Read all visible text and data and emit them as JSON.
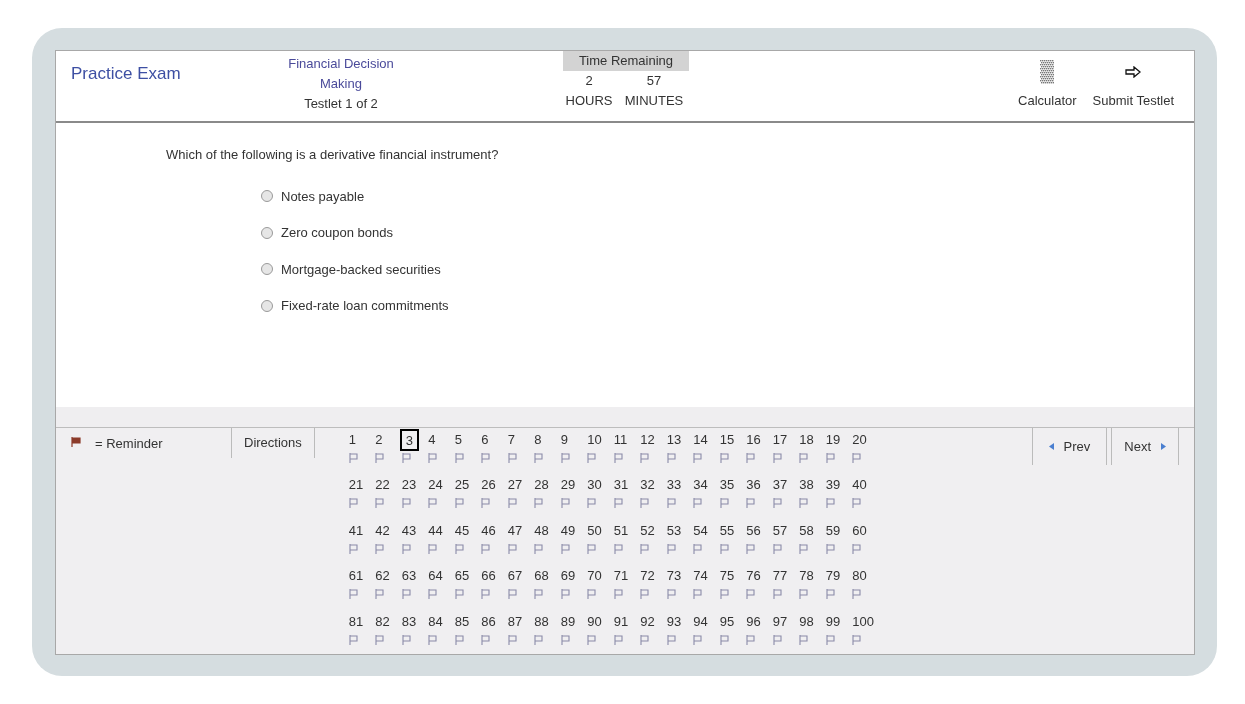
{
  "header": {
    "title": "Practice Exam",
    "section": "Financial Decision Making",
    "testlet": "Testlet 1 of 2",
    "timer": {
      "label": "Time Remaining",
      "hours": "2",
      "minutes": "57",
      "hours_label": "HOURS",
      "minutes_label": "MINUTES"
    },
    "tools": [
      {
        "kind": "calculator",
        "label": "Calculator"
      },
      {
        "kind": "submit",
        "label": "Submit Testlet"
      }
    ]
  },
  "question": {
    "text": "Which of the following is a derivative financial instrument?",
    "options": [
      {
        "label": "Notes payable",
        "selected": false
      },
      {
        "label": "Zero coupon bonds",
        "selected": false
      },
      {
        "label": "Mortgage-backed securities",
        "selected": false
      },
      {
        "label": "Fixed-rate loan commitments",
        "selected": false
      }
    ]
  },
  "footer": {
    "legend": "= Reminder",
    "directions": "Directions",
    "prev": "Prev",
    "next": "Next",
    "questions": [
      {
        "number": "1",
        "selected": false
      },
      {
        "number": "2",
        "selected": false
      },
      {
        "number": "3",
        "selected": true
      },
      {
        "number": "4",
        "selected": false
      },
      {
        "number": "5",
        "selected": false
      },
      {
        "number": "6",
        "selected": false
      },
      {
        "number": "7",
        "selected": false
      },
      {
        "number": "8",
        "selected": false
      },
      {
        "number": "9",
        "selected": false
      },
      {
        "number": "10",
        "selected": false
      },
      {
        "number": "11",
        "selected": false
      },
      {
        "number": "12",
        "selected": false
      },
      {
        "number": "13",
        "selected": false
      },
      {
        "number": "14",
        "selected": false
      },
      {
        "number": "15",
        "selected": false
      },
      {
        "number": "16",
        "selected": false
      },
      {
        "number": "17",
        "selected": false
      },
      {
        "number": "18",
        "selected": false
      },
      {
        "number": "19",
        "selected": false
      },
      {
        "number": "20",
        "selected": false
      },
      {
        "number": "21",
        "selected": false
      },
      {
        "number": "22",
        "selected": false
      },
      {
        "number": "23",
        "selected": false
      },
      {
        "number": "24",
        "selected": false
      },
      {
        "number": "25",
        "selected": false
      },
      {
        "number": "26",
        "selected": false
      },
      {
        "number": "27",
        "selected": false
      },
      {
        "number": "28",
        "selected": false
      },
      {
        "number": "29",
        "selected": false
      },
      {
        "number": "30",
        "selected": false
      },
      {
        "number": "31",
        "selected": false
      },
      {
        "number": "32",
        "selected": false
      },
      {
        "number": "33",
        "selected": false
      },
      {
        "number": "34",
        "selected": false
      },
      {
        "number": "35",
        "selected": false
      },
      {
        "number": "36",
        "selected": false
      },
      {
        "number": "37",
        "selected": false
      },
      {
        "number": "38",
        "selected": false
      },
      {
        "number": "39",
        "selected": false
      },
      {
        "number": "40",
        "selected": false
      },
      {
        "number": "41",
        "selected": false
      },
      {
        "number": "42",
        "selected": false
      },
      {
        "number": "43",
        "selected": false
      },
      {
        "number": "44",
        "selected": false
      },
      {
        "number": "45",
        "selected": false
      },
      {
        "number": "46",
        "selected": false
      },
      {
        "number": "47",
        "selected": false
      },
      {
        "number": "48",
        "selected": false
      },
      {
        "number": "49",
        "selected": false
      },
      {
        "number": "50",
        "selected": false
      },
      {
        "number": "51",
        "selected": false
      },
      {
        "number": "52",
        "selected": false
      },
      {
        "number": "53",
        "selected": false
      },
      {
        "number": "54",
        "selected": false
      },
      {
        "number": "55",
        "selected": false
      },
      {
        "number": "56",
        "selected": false
      },
      {
        "number": "57",
        "selected": false
      },
      {
        "number": "58",
        "selected": false
      },
      {
        "number": "59",
        "selected": false
      },
      {
        "number": "60",
        "selected": false
      },
      {
        "number": "61",
        "selected": false
      },
      {
        "number": "62",
        "selected": false
      },
      {
        "number": "63",
        "selected": false
      },
      {
        "number": "64",
        "selected": false
      },
      {
        "number": "65",
        "selected": false
      },
      {
        "number": "66",
        "selected": false
      },
      {
        "number": "67",
        "selected": false
      },
      {
        "number": "68",
        "selected": false
      },
      {
        "number": "69",
        "selected": false
      },
      {
        "number": "70",
        "selected": false
      },
      {
        "number": "71",
        "selected": false
      },
      {
        "number": "72",
        "selected": false
      },
      {
        "number": "73",
        "selected": false
      },
      {
        "number": "74",
        "selected": false
      },
      {
        "number": "75",
        "selected": false
      },
      {
        "number": "76",
        "selected": false
      },
      {
        "number": "77",
        "selected": false
      },
      {
        "number": "78",
        "selected": false
      },
      {
        "number": "79",
        "selected": false
      },
      {
        "number": "80",
        "selected": false
      },
      {
        "number": "81",
        "selected": false
      },
      {
        "number": "82",
        "selected": false
      },
      {
        "number": "83",
        "selected": false
      },
      {
        "number": "84",
        "selected": false
      },
      {
        "number": "85",
        "selected": false
      },
      {
        "number": "86",
        "selected": false
      },
      {
        "number": "87",
        "selected": false
      },
      {
        "number": "88",
        "selected": false
      },
      {
        "number": "89",
        "selected": false
      },
      {
        "number": "90",
        "selected": false
      },
      {
        "number": "91",
        "selected": false
      },
      {
        "number": "92",
        "selected": false
      },
      {
        "number": "93",
        "selected": false
      },
      {
        "number": "94",
        "selected": false
      },
      {
        "number": "95",
        "selected": false
      },
      {
        "number": "96",
        "selected": false
      },
      {
        "number": "97",
        "selected": false
      },
      {
        "number": "98",
        "selected": false
      },
      {
        "number": "99",
        "selected": false
      },
      {
        "number": "100",
        "selected": false
      }
    ]
  }
}
